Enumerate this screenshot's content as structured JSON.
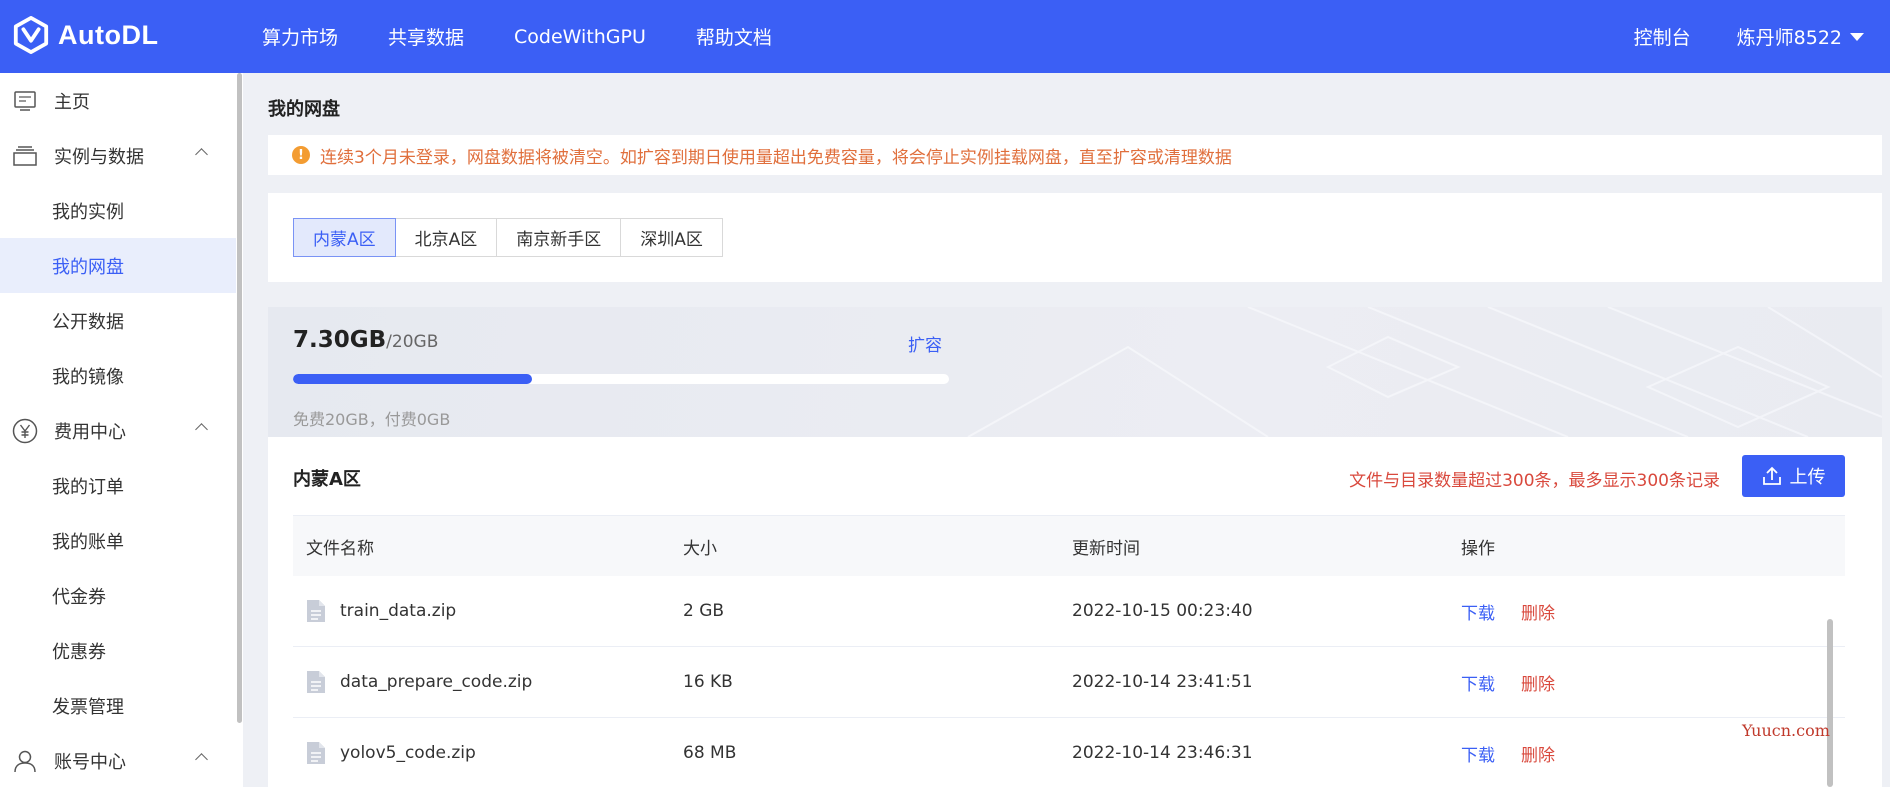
{
  "header": {
    "logo_text": "AutoDL",
    "nav": [
      "算力市场",
      "共享数据",
      "CodeWithGPU",
      "帮助文档"
    ],
    "console": "控制台",
    "username": "炼丹师8522"
  },
  "sidebar": {
    "items": [
      {
        "label": "主页",
        "type": "group",
        "icon": "home-icon"
      },
      {
        "label": "实例与数据",
        "type": "group",
        "icon": "layers-icon",
        "expanded": true
      },
      {
        "label": "我的实例",
        "type": "child"
      },
      {
        "label": "我的网盘",
        "type": "child",
        "active": true
      },
      {
        "label": "公开数据",
        "type": "child"
      },
      {
        "label": "我的镜像",
        "type": "child"
      },
      {
        "label": "费用中心",
        "type": "group",
        "icon": "yen-icon",
        "expanded": true
      },
      {
        "label": "我的订单",
        "type": "child"
      },
      {
        "label": "我的账单",
        "type": "child"
      },
      {
        "label": "代金券",
        "type": "child"
      },
      {
        "label": "优惠券",
        "type": "child"
      },
      {
        "label": "发票管理",
        "type": "child"
      },
      {
        "label": "账号中心",
        "type": "group",
        "icon": "user-icon",
        "expanded": true
      }
    ]
  },
  "main": {
    "title": "我的网盘",
    "notice": "连续3个月未登录，网盘数据将被清空。如扩容到期日使用量超出免费容量，将会停止实例挂载网盘，直至扩容或清理数据",
    "regions": [
      "内蒙A区",
      "北京A区",
      "南京新手区",
      "深圳A区"
    ],
    "active_region": "内蒙A区",
    "storage": {
      "used": "7.30GB",
      "total": "/20GB",
      "expand_label": "扩容",
      "progress_fraction": 0.365,
      "quota_text": "免费20GB，付费0GB"
    },
    "files": {
      "title": "内蒙A区",
      "warning": "文件与目录数量超过300条，最多显示300条记录",
      "upload_label": "上传",
      "columns": [
        "文件名称",
        "大小",
        "更新时间",
        "操作"
      ],
      "rows": [
        {
          "name": "train_data.zip",
          "size": "2 GB",
          "updated": "2022-10-15 00:23:40",
          "download": "下载",
          "delete": "删除"
        },
        {
          "name": "data_prepare_code.zip",
          "size": "16 KB",
          "updated": "2022-10-14 23:41:51",
          "download": "下载",
          "delete": "删除"
        },
        {
          "name": "yolov5_code.zip",
          "size": "68 MB",
          "updated": "2022-10-14 23:46:31",
          "download": "下载",
          "delete": "删除"
        }
      ]
    }
  },
  "watermark": "Yuucn.com",
  "colors": {
    "brand": "#3b5ff5",
    "danger": "#d9493d",
    "warning": "#e06f3c"
  }
}
